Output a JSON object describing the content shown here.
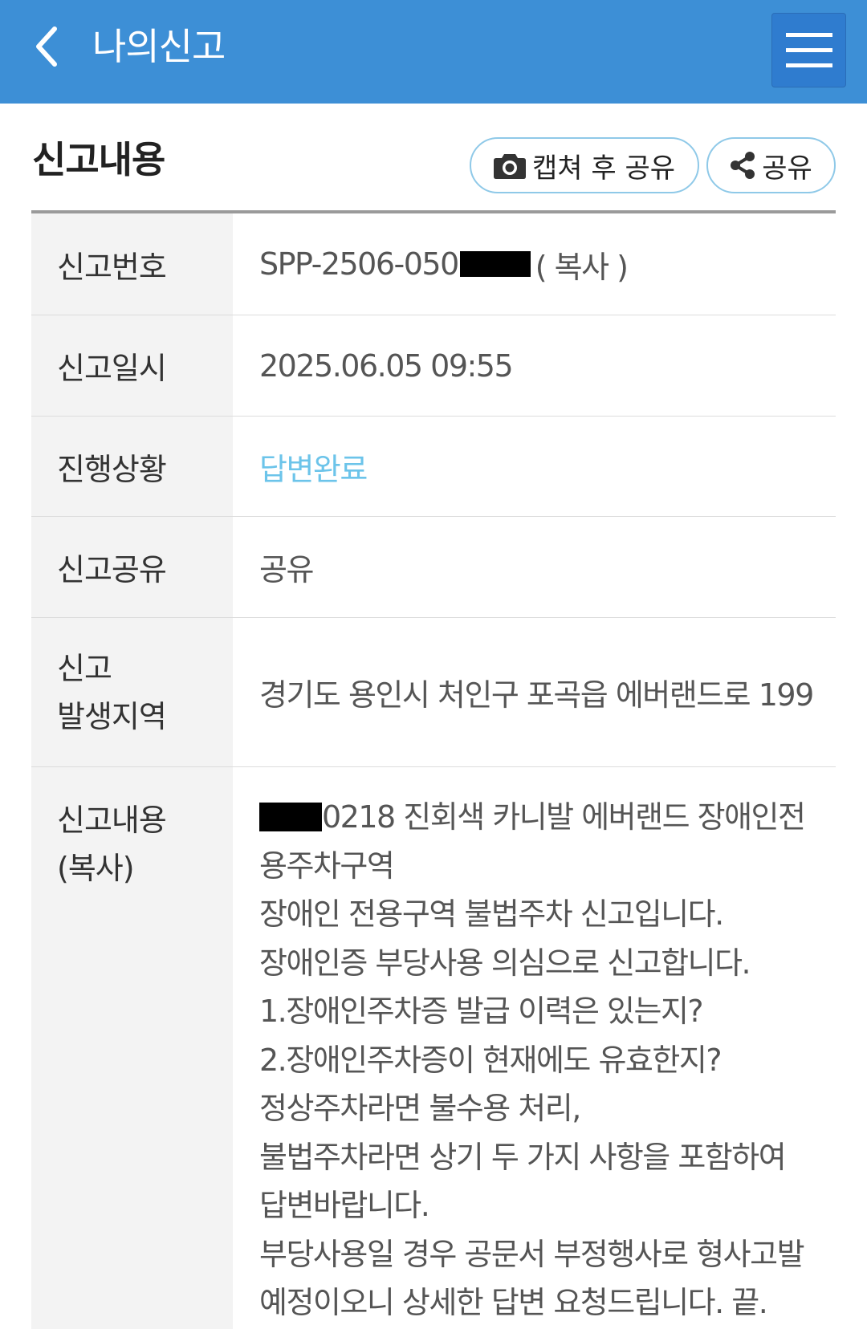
{
  "header": {
    "title": "나의신고",
    "back_icon": "chevron-left-icon",
    "menu_icon": "hamburger-menu-icon",
    "background_color": "#3d8fd6"
  },
  "section": {
    "title": "신고내용",
    "capture_share_label": "캡쳐 후 공유",
    "capture_icon": "camera-icon",
    "share_label": "공유",
    "share_icon": "share-icon",
    "button_border_color": "#8fc9e8"
  },
  "report": {
    "number": {
      "label": "신고번호",
      "value_prefix": "SPP-2506-050",
      "copy_label": "( 복사 )"
    },
    "datetime": {
      "label": "신고일시",
      "value": "2025.06.05 09:55"
    },
    "status": {
      "label": "진행상황",
      "value": "답변완료",
      "color": "#6cc4ea"
    },
    "share": {
      "label": "신고공유",
      "value": "공유"
    },
    "location": {
      "label": "신고\n발생지역",
      "value": "경기도 용인시 처인구 포곡읍 에버랜드로 199"
    },
    "content": {
      "label": "신고내용\n(복사)",
      "first_line_suffix": "0218 진회색 카니발 에버랜드 장애인전",
      "lines": [
        "용주차구역",
        "장애인 전용구역 불법주차 신고입니다.",
        "장애인증 부당사용 의심으로 신고합니다.",
        "1.장애인주차증 발급 이력은 있는지?",
        "2.장애인주차증이 현재에도 유효한지?",
        "정상주차라면 불수용 처리,",
        "불법주차라면 상기 두 가지 사항을 포함하여",
        "답변바랍니다.",
        "부당사용일 경우 공문서 부정행사로 형사고발",
        "예정이오니 상세한 답변 요청드립니다. 끝."
      ]
    }
  }
}
